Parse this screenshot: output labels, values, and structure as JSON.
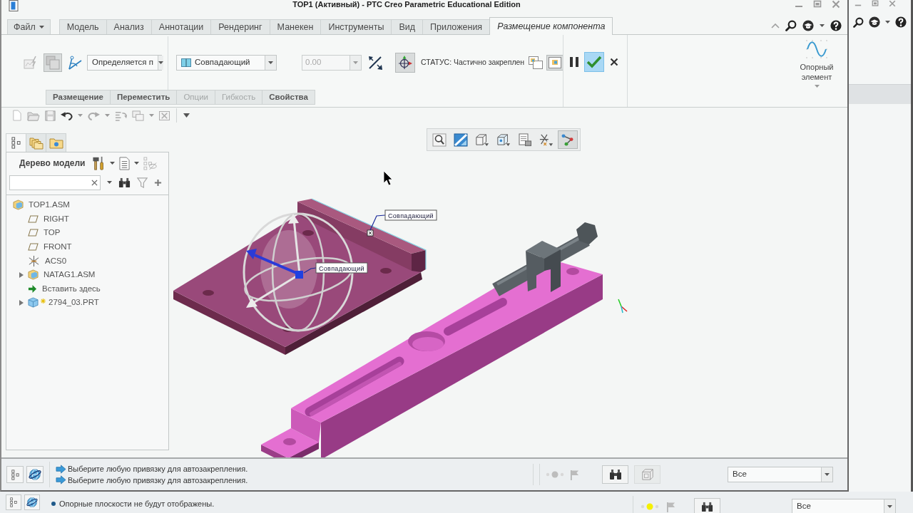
{
  "window": {
    "title": "TOP1 (Активный) - PTC Creo Parametric Educational Edition"
  },
  "ribbon_tabs": [
    {
      "label": "Файл",
      "kind": "menu",
      "selected": false
    },
    {
      "label": "Модель",
      "kind": "tab",
      "selected": false
    },
    {
      "label": "Анализ",
      "kind": "tab",
      "selected": false
    },
    {
      "label": "Аннотации",
      "kind": "tab",
      "selected": false
    },
    {
      "label": "Рендеринг",
      "kind": "tab",
      "selected": false
    },
    {
      "label": "Манекен",
      "kind": "tab",
      "selected": false
    },
    {
      "label": "Инструменты",
      "kind": "tab",
      "selected": false
    },
    {
      "label": "Вид",
      "kind": "tab",
      "selected": false
    },
    {
      "label": "Приложения",
      "kind": "tab",
      "selected": false
    },
    {
      "label": "Размещение компонента",
      "kind": "tab",
      "selected": true
    }
  ],
  "ribbon": {
    "tools": [
      {
        "kind": "auto",
        "pressed": false
      },
      {
        "kind": "user",
        "pressed": true
      },
      {
        "kind": "mechanism",
        "pressed": false
      }
    ],
    "constraint_set": {
      "value": "Определяется п"
    },
    "constraint_type": {
      "value": "Совпадающий"
    },
    "offset": {
      "value": "0.00",
      "disabled": true
    },
    "placement_tools": [
      {
        "kind": "flip",
        "pressed": false
      },
      {
        "kind": "placement",
        "pressed": true
      }
    ],
    "status": "СТАТУС: Частично закреплен",
    "window_tools": [
      {
        "kind": "separate",
        "pressed": false
      },
      {
        "kind": "assembly",
        "pressed": true
      }
    ],
    "actions": [
      {
        "kind": "pause",
        "highlighted": false
      },
      {
        "kind": "ok",
        "highlighted": true
      },
      {
        "kind": "cancel",
        "highlighted": false
      }
    ],
    "datum": {
      "label": "Опорный элемент"
    }
  },
  "sub_tabs": [
    {
      "label": "Размещение",
      "disabled": false
    },
    {
      "label": "Переместить",
      "disabled": false
    },
    {
      "label": "Опции",
      "disabled": true
    },
    {
      "label": "Гибкость",
      "disabled": true
    },
    {
      "label": "Свойства",
      "disabled": false
    }
  ],
  "view_toolbar": [
    {
      "kind": "refit",
      "pressed": false
    },
    {
      "kind": "repaint",
      "pressed": false
    },
    {
      "kind": "style",
      "pressed": false
    },
    {
      "kind": "orient",
      "pressed": false
    },
    {
      "kind": "manager",
      "pressed": false
    },
    {
      "kind": "datums",
      "pressed": false
    },
    {
      "kind": "snap",
      "pressed": true
    }
  ],
  "panel_tabs": [
    {
      "kind": "tree",
      "selected": true
    },
    {
      "kind": "folders",
      "selected": false
    },
    {
      "kind": "favorites",
      "selected": false
    }
  ],
  "model_tree": {
    "title": "Дерево модели",
    "items": [
      {
        "label": "TOP1.ASM",
        "kind": "assembly",
        "children": [
          {
            "label": "RIGHT",
            "kind": "plane"
          },
          {
            "label": "TOP",
            "kind": "plane"
          },
          {
            "label": "FRONT",
            "kind": "plane"
          },
          {
            "label": "ACS0",
            "kind": "csys"
          },
          {
            "label": "NATAG1.ASM",
            "kind": "assembly",
            "expanded": false
          },
          {
            "label": "Вставить здесь",
            "kind": "insert"
          },
          {
            "label": "2794_03.PRT",
            "kind": "new_part",
            "expanded": false
          }
        ]
      }
    ]
  },
  "graphics": {
    "callouts": [
      "Совпадающий",
      "Совпадающий"
    ]
  },
  "status_bar": {
    "messages": [
      "Выберите любую привязку для автозакрепления.",
      "Выберите любую привязку для автозакрепления."
    ],
    "filter": "Все"
  },
  "background_window": {
    "message": "Опорные плоскости не будут отображены.",
    "filter": "Все"
  }
}
